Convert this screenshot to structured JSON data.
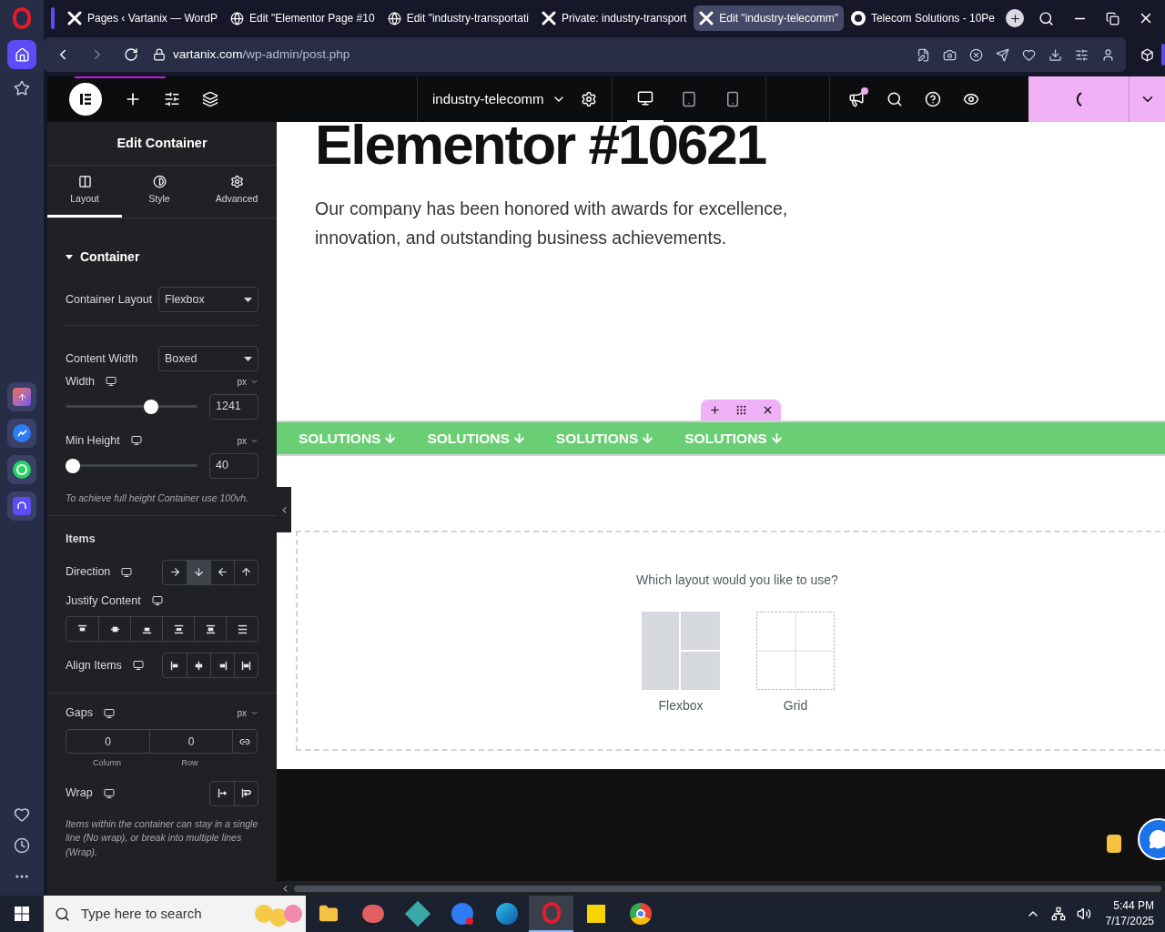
{
  "browser": {
    "tabs": [
      {
        "title": "Pages ‹ Vartanix — WordP",
        "selected": false
      },
      {
        "title": "Edit \"Elementor Page #10",
        "selected": false
      },
      {
        "title": "Edit \"industry-transportati",
        "selected": false
      },
      {
        "title": "Private: industry-transport",
        "selected": false
      },
      {
        "title": "Edit \"industry-telecomm\"",
        "selected": true
      },
      {
        "title": "Telecom Solutions - 10Pe",
        "selected": false
      }
    ],
    "address": {
      "host": "vartanix.com",
      "path": "/wp-admin/post.php"
    }
  },
  "editor_bar": {
    "document": "industry-telecomm",
    "devices": [
      {
        "selected": true
      },
      {
        "selected": false
      },
      {
        "selected": false
      }
    ],
    "notification": true
  },
  "panel": {
    "title": "Edit Container",
    "tabs": [
      {
        "label": "Layout",
        "selected": true
      },
      {
        "label": "Style",
        "selected": false
      },
      {
        "label": "Advanced",
        "selected": false
      }
    ],
    "section": {
      "title": "Container",
      "expanded": true
    },
    "container_layout": {
      "label": "Container Layout",
      "value": "Flexbox"
    },
    "content_width": {
      "label": "Content Width",
      "value": "Boxed"
    },
    "width": {
      "label": "Width",
      "unit": "px",
      "level": 0.67,
      "value": "1241"
    },
    "min_height": {
      "label": "Min Height",
      "unit": "px",
      "level": 0,
      "value": "40"
    },
    "min_height_note": "To achieve full height Container use 100vh.",
    "items_heading": "Items",
    "direction": {
      "label": "Direction",
      "options": [
        {
          "selected": false
        },
        {
          "selected": true
        },
        {
          "selected": false
        },
        {
          "selected": false
        }
      ]
    },
    "justify": {
      "label": "Justify Content",
      "options": [
        {
          "selected": false
        },
        {
          "selected": false
        },
        {
          "selected": false
        },
        {
          "selected": false
        },
        {
          "selected": false
        },
        {
          "selected": false
        }
      ]
    },
    "align": {
      "label": "Align Items",
      "options": [
        {
          "selected": false
        },
        {
          "selected": false
        },
        {
          "selected": false
        },
        {
          "selected": false
        }
      ]
    },
    "gaps": {
      "label": "Gaps",
      "unit": "px",
      "column": "0",
      "row": "0",
      "column_label": "Column",
      "row_label": "Row"
    },
    "wrap": {
      "label": "Wrap",
      "options": [
        {
          "selected": false
        },
        {
          "selected": false
        }
      ]
    },
    "wrap_note": "Items within the container can stay in a single line (No wrap), or break into multiple lines (Wrap)."
  },
  "canvas": {
    "heading": "Elementor #10621",
    "paragraph": "Our company has been honored with awards for excellence, innovation, and outstanding business achievements.",
    "nav_items": [
      "SOLUTIONS",
      "SOLUTIONS",
      "SOLUTIONS",
      "SOLUTIONS"
    ],
    "layout_prompt": "Which layout would you like to use?",
    "layout_options": [
      {
        "label": "Flexbox"
      },
      {
        "label": "Grid"
      }
    ]
  },
  "taskbar": {
    "search_placeholder": "Type here to search",
    "time": "5:44 PM",
    "date": "7/17/2025"
  }
}
